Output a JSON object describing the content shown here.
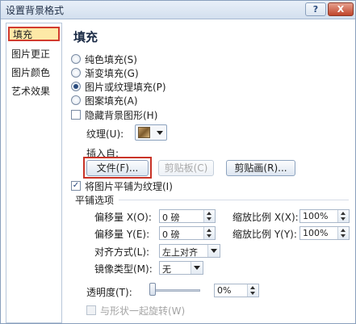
{
  "window": {
    "title": "设置背景格式",
    "help_label": "?",
    "close_label": "X"
  },
  "sidebar": {
    "items": [
      {
        "label": "填充"
      },
      {
        "label": "图片更正"
      },
      {
        "label": "图片颜色"
      },
      {
        "label": "艺术效果"
      }
    ]
  },
  "fill": {
    "heading": "填充",
    "options": [
      {
        "label": "纯色填充(S)"
      },
      {
        "label": "渐变填充(G)"
      },
      {
        "label": "图片或纹理填充(P)"
      },
      {
        "label": "图案填充(A)"
      }
    ],
    "selected": "图片或纹理填充(P)",
    "hide_bg_label": "隐藏背景图形(H)",
    "texture_label": "纹理(U):",
    "insert_from_label": "插入自:",
    "file_button": "文件(F)...",
    "clipboard_button": "剪贴板(C)",
    "clipart_button": "剪贴画(R)...",
    "tile_label": "将图片平铺为纹理(I)",
    "tile_checked": true,
    "tile_section_label": "平铺选项",
    "offset_x_label": "偏移量 X(O):",
    "offset_x_value": "0 磅",
    "scale_x_label": "缩放比例 X(X):",
    "scale_x_value": "100%",
    "offset_y_label": "偏移量 Y(E):",
    "offset_y_value": "0 磅",
    "scale_y_label": "缩放比例 Y(Y):",
    "scale_y_value": "100%",
    "align_label": "对齐方式(L):",
    "align_value": "左上对齐",
    "mirror_label": "镜像类型(M):",
    "mirror_value": "无",
    "transparency_label": "透明度(T):",
    "transparency_value": "0%",
    "rotate_label": "与形状一起旋转(W)",
    "check_mark": "✓"
  }
}
